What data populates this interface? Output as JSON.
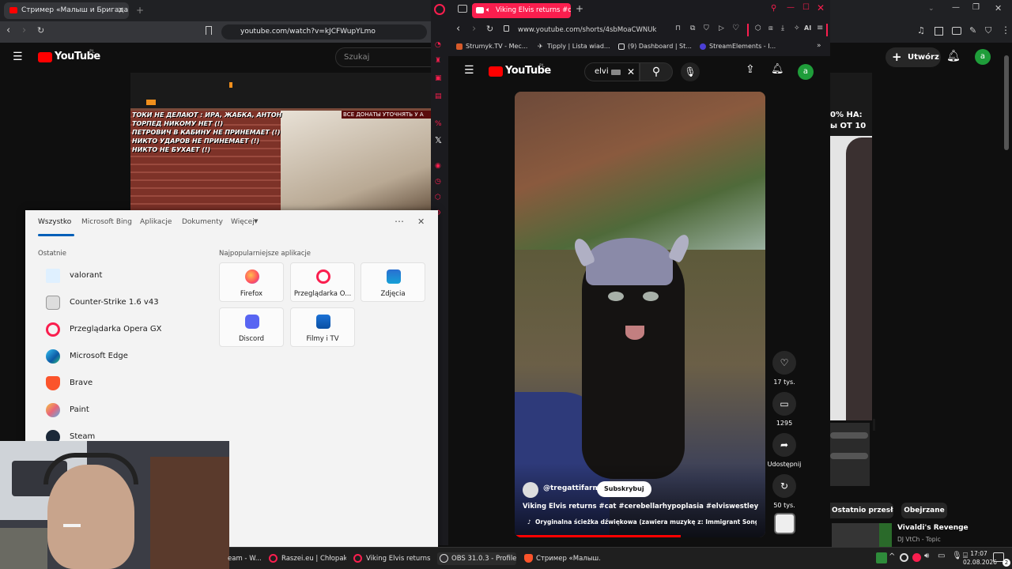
{
  "left_browser": {
    "tab_title": "Стример «Малыш и Бригада»",
    "url": "youtube.com/watch?v=kJCFWupYLmo",
    "yt_logo": "YouTube",
    "yt_region": "PL",
    "search_placeholder": "Szukaj",
    "stream_overlay_lines": [
      "ТОКИ НЕ ДЕЛАЮТ : ИРА, ЖАБКА, АНТОН",
      "ТОРПЕД НИКОМУ НЕТ (!)",
      "ПЕТРОВИЧ В КАБИНУ НЕ ПРИНЕМАЕТ (!)",
      "НИКТО УДАРОВ НЕ ПРИНЕМАЕТ (!)",
      "НИКТО НЕ БУХАЕТ (!)"
    ],
    "stream_banner": "ВСЕ ДОНАТЫ УТОЧНЯТЬ У А"
  },
  "opera": {
    "tab_title": "Viking Elvis returns #ca",
    "url": "www.youtube.com/shorts/4sbMoaCWNUk",
    "bookmarks": [
      "Strumyk.TV - Mec...",
      "Tipply | Lista wiad...",
      "(9) Dashboard | St...",
      "StreamElements - I..."
    ],
    "yt_logo": "YouTube",
    "yt_region": "PL",
    "search_value": "elvi",
    "avatar_letter": "a"
  },
  "short": {
    "channel": "@tregattifarms",
    "subscribe": "Subskrybuj",
    "title": "Viking Elvis returns #cat #cerebellarhypoplasia #elviswestley #vikings",
    "audio": "Oryginalna ścieżka dźwiękowa (zawiera muzykę z: Immigrant Song (Remas...",
    "likes": "17 tys.",
    "comments": "1295",
    "share": "Udostępnij",
    "remix": "50 tys."
  },
  "right_yt": {
    "create": "Utwórz",
    "avatar_letter": "a",
    "overlay_text_1": "0% НА:",
    "overlay_text_2": "ы ОТ 10",
    "chip_recent": "Ostatnio przesłane",
    "chip_watched": "Obejrzane",
    "rec_title": "Vivaldi's Revenge",
    "rec_channel": "DJ VtCh - Topic"
  },
  "start_menu": {
    "tabs": [
      "Wszystko",
      "Microsoft Bing",
      "Aplikacje",
      "Dokumenty",
      "Więcej"
    ],
    "recent_heading": "Ostatnie",
    "recent": [
      "valorant",
      "Counter-Strike 1.6 v43",
      "Przeglądarka Opera GX",
      "Microsoft Edge",
      "Brave",
      "Paint",
      "Steam"
    ],
    "popular_heading": "Najpopularniejsze aplikacje",
    "popular": [
      "Firefox",
      "Przeglądarka O...",
      "Zdjęcia",
      "Discord",
      "Filmy i TV"
    ]
  },
  "taskbar": {
    "items": [
      "eam - W...",
      "Raszei.eu | Chłopak...",
      "Viking Elvis returns ...",
      "OBS 31.0.3 - Profile:...",
      "Стример «Малыш..."
    ],
    "time": "17:07",
    "date": "02.08.2026",
    "notifications": "2"
  },
  "colors": {
    "yt_red": "#ff0000",
    "opera_red": "#fa1e4e",
    "accent_green": "#1f9d3a"
  }
}
